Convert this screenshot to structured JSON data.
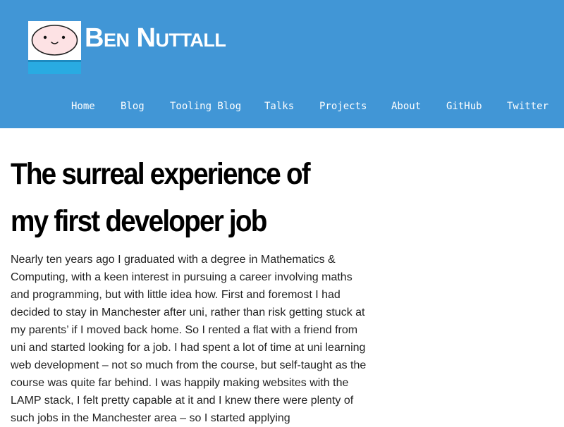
{
  "site": {
    "title": "Ben Nuttall"
  },
  "nav": {
    "items": [
      {
        "label": "Home"
      },
      {
        "label": "Blog"
      },
      {
        "label": "Tooling Blog"
      },
      {
        "label": "Talks"
      },
      {
        "label": "Projects"
      },
      {
        "label": "About"
      },
      {
        "label": "GitHub"
      },
      {
        "label": "Twitter"
      }
    ]
  },
  "post": {
    "title": "The surreal experience of my first developer job",
    "body": "Nearly ten years ago I graduated with a degree in Mathematics & Computing, with a keen interest in pursuing a career involving maths and programming, but with little idea how. First and foremost I had decided to stay in Manchester after uni, rather than risk getting stuck at my parents’ if I moved back home. So I rented a flat with a friend from uni and started looking for a job. I had spent a lot of time at uni learning web development – not so much from the course, but self-taught as the course was quite far behind. I was happily making websites with the LAMP stack, I felt pretty capable at it and I knew there were plenty of such jobs in the Manchester area – so I started applying"
  },
  "colors": {
    "header_bg": "#4196d6",
    "header_text": "#ffffff",
    "body_text": "#222222",
    "avatar_face": "#fde2e4",
    "avatar_band": "#29abe2"
  },
  "icons": {
    "avatar": "finn-the-human-face-icon"
  }
}
